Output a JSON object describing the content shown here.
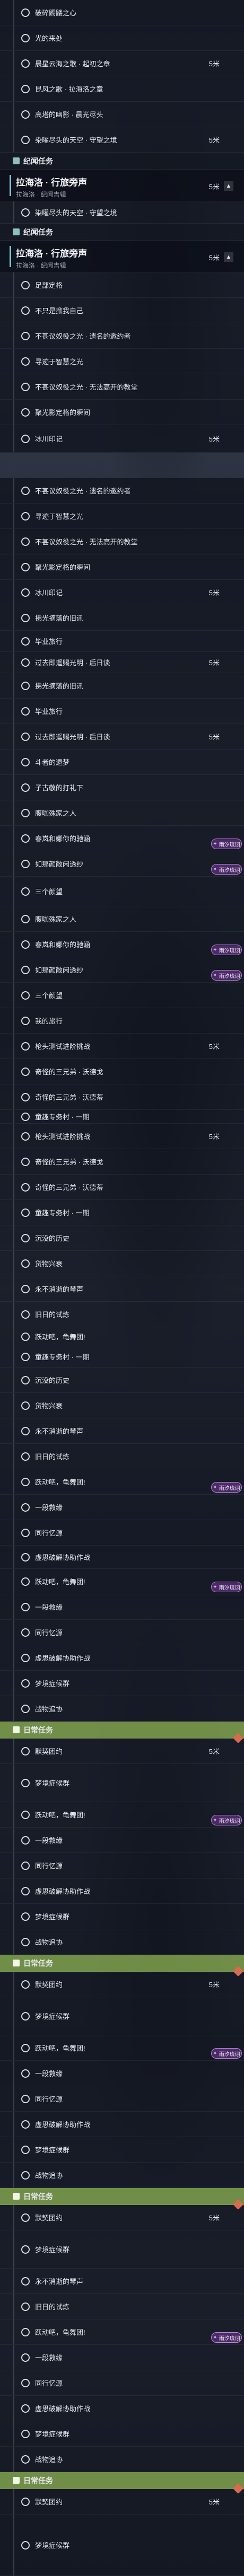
{
  "distance_unit": "5米",
  "categories": {
    "wind": "纪闻任务",
    "daily": "日常任务"
  },
  "top_card": {
    "title": "拉海洛 · 行旅旁声",
    "subtitle": "拉海洛 · 纪闻吉辑",
    "distance": "5米",
    "toggle": "▲"
  },
  "quests": {
    "q01": "破碎髑髅之心",
    "q02": "光的来处",
    "q03": "晨星云海之歌 · 起初之章",
    "q04": "昆风之歌 · 拉海洛之章",
    "q05": "昆风之歌 · 拉海洛之章",
    "q06": "高塔的幽影 · 晨光尽头",
    "q07": "染曜尽头的天空 · 守望之境",
    "q08": "足部定格",
    "q09": "不只是掀我自己",
    "q10": "不甚议奴役之光 · 遗名的邀约者",
    "q11": "寻迹于智慧之光",
    "q12": "不甚议奴役之光 · 无法高开的教堂",
    "q13": "聚光影定格的瞬间",
    "q14": "冰川印记",
    "q15": "拂光摘落的旧讯",
    "q16": "毕业旅行",
    "q17": "过去即遥赐光明 · 后日谈",
    "q18": "斗者的遗梦",
    "q19": "子古敬的打礼下",
    "q20": "腹咖殊家之人",
    "q21": "春岚和娜你的驰涵",
    "q22": "如那颜敞闲透纱",
    "q23": "三个颜望",
    "q24": "我的旅行",
    "q25": "枪头测试进阶挑战",
    "q26": "奇怪的三兄弟 · 沃德戈",
    "q27": "奇怪的三兄弟 · 沃德蒂",
    "q28": "童趣专务村 · 一期",
    "q29": "沉没的历史",
    "q30": "货物兴衰",
    "q31": "永不消逝的琴声",
    "q32": "旧日的试炼",
    "q33": "跃动吧，龟舞团!",
    "q34": "一段救缘",
    "q35": "同行忆源",
    "q36": "虚思破解协助作战",
    "q37": "梦境症候群",
    "q38": "战物追协",
    "q39": "默契团约"
  },
  "badge": {
    "label": "雨汐琉诩",
    "icon": "sparkle-badge-icon"
  },
  "colors": {
    "daily_header": "#769648",
    "badge_bg": "#4b2a66",
    "badge_border": "#b48ad8",
    "accent": "#7ec9d8"
  }
}
